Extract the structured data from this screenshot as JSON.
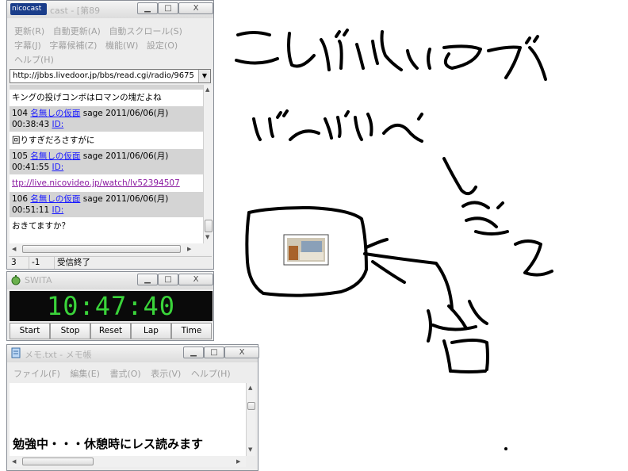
{
  "nicocast": {
    "logo": "nicocast",
    "title": "cast - [第89",
    "menu_row1": [
      "更新(R)",
      "自動更新(A)",
      "自動スクロール(S)"
    ],
    "menu_row2": [
      "字幕(J)",
      "字幕候補(Z)",
      "機能(W)",
      "設定(O)"
    ],
    "menu_row3": [
      "ヘルプ(H)"
    ],
    "url": "http://jbbs.livedoor.jp/bbs/read.cgi/radio/9675",
    "partial_message": "キングの投げコンボはロマンの塊だよね",
    "posts": [
      {
        "num": "104",
        "name": "名無しの仮面",
        "meta": "sage 2011/06/06(月)",
        "time": "00:38:43",
        "id": "ID:",
        "body": "回りすぎだろさすがに"
      },
      {
        "num": "105",
        "name": "名無しの仮面",
        "meta": "sage 2011/06/06(月)",
        "time": "00:41:55",
        "id": "ID:",
        "link": "ttp://live.nicovideo.jp/watch/lv52394507"
      },
      {
        "num": "106",
        "name": "名無しの仮面",
        "meta": "sage 2011/06/06(月)",
        "time": "00:51:11",
        "id": "ID:",
        "body": "おきてますか？"
      }
    ],
    "status": [
      "3",
      "-1",
      "受信終了"
    ]
  },
  "swita": {
    "title": "SWITA",
    "time": "10:47:40",
    "buttons": [
      "Start",
      "Stop",
      "Reset",
      "Lap",
      "Time"
    ]
  },
  "notepad": {
    "title": "メモ.txt - メモ帳",
    "menu": [
      "ファイル(F)",
      "編集(E)",
      "書式(O)",
      "表示(V)",
      "ヘルプ(H)"
    ],
    "text": "勉強中・・・休憩時にレス読みます"
  },
  "window_buttons": {
    "minimize": "▁",
    "maximize": "□",
    "close": "X"
  },
  "colors": {
    "timer_bg": "#0a0a0a",
    "timer_digits": "#3ad43a",
    "logo_bg": "#1a3d8a",
    "link": "#1a1aff",
    "visited_link": "#8a1aa0"
  }
}
